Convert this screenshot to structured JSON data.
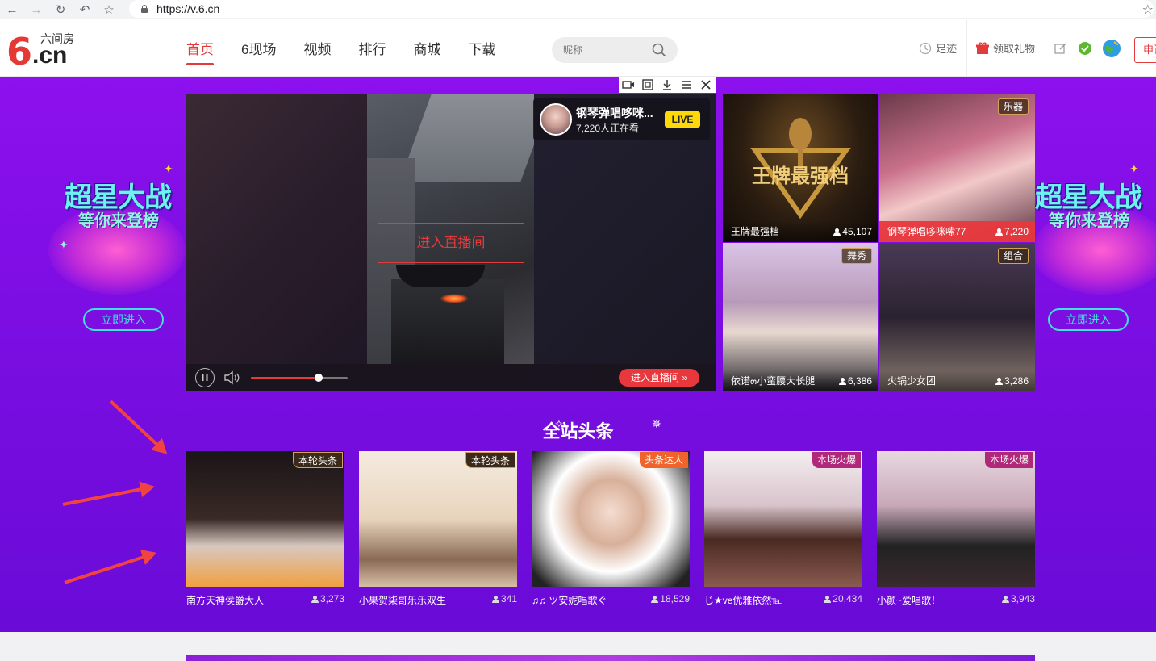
{
  "browser": {
    "url": "https://v.6.cn",
    "icons": [
      "back-icon",
      "forward-icon",
      "reload-icon",
      "undo-icon",
      "bookmark-star-icon",
      "lock-icon"
    ]
  },
  "header": {
    "logo_main": "6",
    "logo_cn": ".cn",
    "logo_sub": "六间房",
    "nav": [
      "首页",
      "6现场",
      "视频",
      "排行",
      "商城",
      "下载"
    ],
    "active_nav": "首页",
    "search_placeholder": "昵称",
    "footprint_label": "足迹",
    "gift_label": "领取礼物",
    "apply_label": "申请"
  },
  "promo": {
    "title": "超星大战",
    "subtitle": "等你来登榜",
    "button": "立即进入"
  },
  "player": {
    "overlay_enter": "进入直播间",
    "streamer_name": "钢琴弹唱哆咪...",
    "viewers": "7,220人正在看",
    "live_badge": "LIVE",
    "enter_button": "进入直播间 »",
    "volume": 0.7,
    "tools": [
      "camera-icon",
      "fullscreen-icon",
      "download-icon",
      "menu-icon",
      "close-icon"
    ]
  },
  "thumbs": [
    {
      "name": "王牌最强档",
      "count": "45,107",
      "category": "",
      "art_text": "王牌最强档"
    },
    {
      "name": "钢琴弹唱哆咪嗦77",
      "count": "7,220",
      "category": "乐器",
      "highlighted": true
    },
    {
      "name": "依诺๓小蛮腰大长腿",
      "count": "6,386",
      "category": "舞秀"
    },
    {
      "name": "火锅少女团",
      "count": "3,286",
      "category": "组合"
    }
  ],
  "headlines": {
    "title": "全站头条",
    "items": [
      {
        "name": "南方天神侯爵大人",
        "count": "3,273",
        "tag": "本轮头条",
        "tag_color": "#3b2a1a"
      },
      {
        "name": "小果贺柒哥乐乐双生",
        "count": "341",
        "tag": "本轮头条",
        "tag_color": "#3b2a1a"
      },
      {
        "name": "♫♫ ツ安妮唱歌ぐ",
        "count": "18,529",
        "tag": "头条达人",
        "tag_color": "#f0632a"
      },
      {
        "name": "じ★ve优雅依然℡",
        "count": "20,434",
        "tag": "本场火爆",
        "tag_color": "#b0287a"
      },
      {
        "name": "小颜~爱唱歌！",
        "count": "3,943",
        "tag": "本场火爆",
        "tag_color": "#b0287a"
      }
    ]
  },
  "colors": {
    "brand_red": "#e23b3b",
    "banner_purple": "#8d10ee",
    "teal": "#3de3dc",
    "live_yellow": "#ffd80a"
  }
}
